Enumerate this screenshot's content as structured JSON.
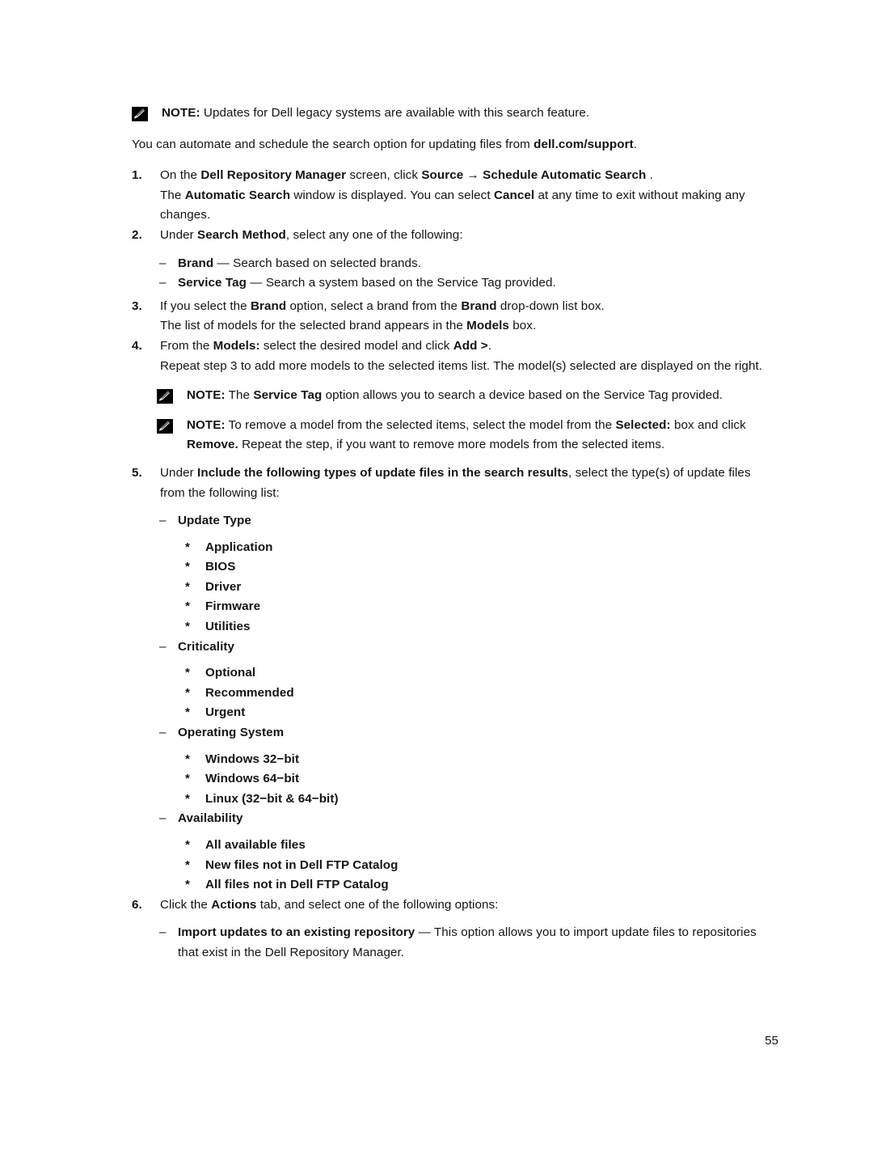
{
  "page": {
    "number": "55"
  },
  "notes": {
    "icon_name": "note-pencil-icon",
    "label": "NOTE:",
    "top": {
      "text_a": " Updates for Dell legacy systems are available with this search feature."
    },
    "service_tag": {
      "text_a": " The ",
      "bold_a": "Service Tag",
      "text_b": " option allows you to search a device based on the Service Tag provided."
    },
    "remove_model": {
      "text_a": " To remove a model from the selected items, select the model from the ",
      "bold_a": "Selected:",
      "text_b": " box and click ",
      "bold_b": "Remove.",
      "text_c": " Repeat the step, if you want to remove more models from the selected items."
    }
  },
  "intro_paragraph": {
    "text_a": "You can automate and schedule the search option for updating files from ",
    "bold_a": "dell.com/support",
    "text_b": "."
  },
  "steps": [
    {
      "number": "1.",
      "text_a": "On the ",
      "bold_a": "Dell Repository Manager",
      "text_b": " screen, click ",
      "bold_b": "Source → Schedule Automatic Search",
      "text_c": " .",
      "continuation": {
        "text_a": "The ",
        "bold_a": "Automatic Search",
        "text_b": " window is displayed. You can select ",
        "bold_b": "Cancel",
        "text_c": " at any time to exit without making any changes."
      }
    },
    {
      "number": "2.",
      "text_a": "Under ",
      "bold_a": "Search Method",
      "text_b": ", select any one of the following:"
    },
    {
      "number": "3.",
      "text_a": "If you select the ",
      "bold_a": "Brand",
      "text_b": " option, select a brand from the ",
      "bold_b": "Brand",
      "text_c": " drop-down list box.",
      "continuation": {
        "text_a": "The list of models for the selected brand appears in the ",
        "bold_a": "Models",
        "text_b": " box."
      }
    },
    {
      "number": "4.",
      "text_a": "From the ",
      "bold_a": "Models:",
      "text_b": " select the desired model and click ",
      "bold_b": "Add >",
      "text_c": ".",
      "continuation": {
        "text_a": "Repeat step 3 to add more models to the selected items list. The model(s) selected are displayed on the right."
      }
    },
    {
      "number": "5.",
      "text_a": "Under ",
      "bold_a": "Include the following types of update files in the search results",
      "text_b": ", select the type(s) of update files from the following list:"
    },
    {
      "number": "6.",
      "text_a": "Click the ",
      "bold_a": "Actions",
      "text_b": " tab, and select one of the following options:"
    }
  ],
  "search_method_options": [
    {
      "dash": "–",
      "bold": "Brand",
      "rest": " — Search based on selected brands."
    },
    {
      "dash": "–",
      "bold": "Service Tag",
      "rest": " — Search a system based on the Service Tag provided."
    }
  ],
  "update_file_types": [
    {
      "dash": "–",
      "label": "Update Type",
      "items": [
        {
          "star": "*",
          "label": "Application"
        },
        {
          "star": "*",
          "label": "BIOS"
        },
        {
          "star": "*",
          "label": "Driver"
        },
        {
          "star": "*",
          "label": "Firmware"
        },
        {
          "star": "*",
          "label": "Utilities"
        }
      ]
    },
    {
      "dash": "–",
      "label": "Criticality",
      "items": [
        {
          "star": "*",
          "label": "Optional"
        },
        {
          "star": "*",
          "label": "Recommended"
        },
        {
          "star": "*",
          "label": "Urgent"
        }
      ]
    },
    {
      "dash": "–",
      "label": "Operating System",
      "items": [
        {
          "star": "*",
          "label": "Windows 32−bit"
        },
        {
          "star": "*",
          "label": "Windows 64−bit"
        },
        {
          "star": "*",
          "label": "Linux (32−bit & 64−bit)"
        }
      ]
    },
    {
      "dash": "–",
      "label": "Availability",
      "items": [
        {
          "star": "*",
          "label": "All available files"
        },
        {
          "star": "*",
          "label": "New files not in Dell FTP Catalog"
        },
        {
          "star": "*",
          "label": "All files not in Dell FTP Catalog"
        }
      ]
    }
  ],
  "action_options": [
    {
      "dash": "–",
      "bold": "Import updates to an existing repository",
      "rest": " — This option allows you to import update files to repositories that exist in the Dell Repository Manager."
    }
  ]
}
